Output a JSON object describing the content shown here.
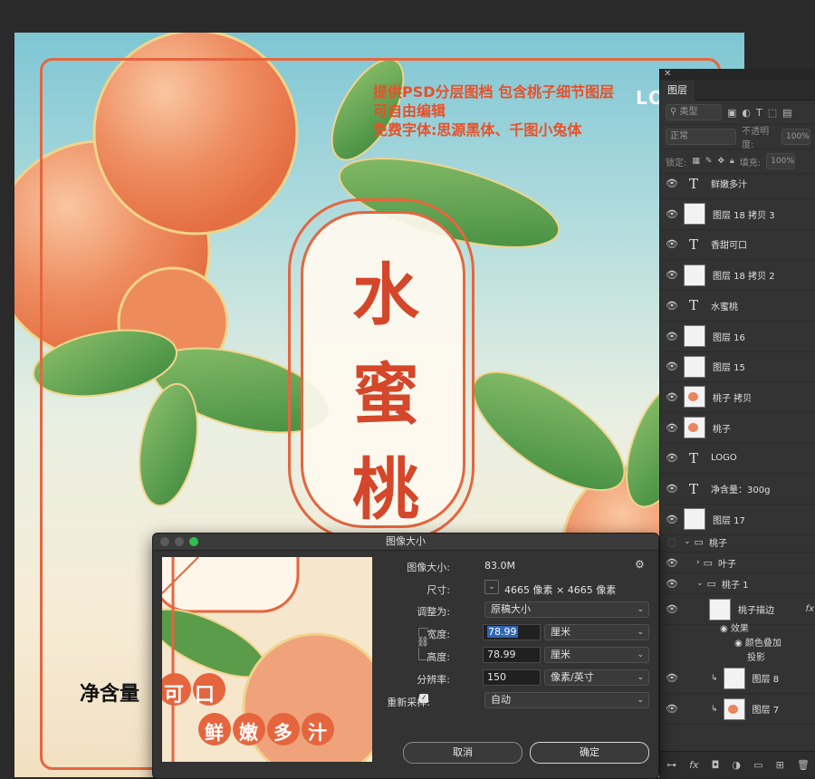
{
  "canvas": {
    "promo_lines": [
      "提供PSD分层图档 包含桃子细节图层",
      "可自由编辑",
      "免费字体:思源黑体、千图小兔体"
    ],
    "logo_text": "LOG",
    "title_chars": [
      "水",
      "蜜",
      "桃"
    ],
    "net_weight": "净含量"
  },
  "layers_panel": {
    "tab": "图层",
    "filter_kind": "类型",
    "blend_mode": "正常",
    "opacity_label": "不透明度:",
    "opacity_value": "100%",
    "lock_label": "锁定:",
    "fill_label": "填充:",
    "fill_value": "100%",
    "layers": [
      {
        "name": "鲜嫩多汁",
        "kind": "text"
      },
      {
        "name": "图层 18 拷贝 3",
        "kind": "pixel"
      },
      {
        "name": "香甜可口",
        "kind": "text"
      },
      {
        "name": "图层 18 拷贝 2",
        "kind": "pixel"
      },
      {
        "name": "水蜜桃",
        "kind": "text"
      },
      {
        "name": "图层 16",
        "kind": "pixel"
      },
      {
        "name": "图层 15",
        "kind": "pixel"
      },
      {
        "name": "桃子 拷贝",
        "kind": "peach"
      },
      {
        "name": "桃子",
        "kind": "peach"
      },
      {
        "name": "LOGO",
        "kind": "text"
      },
      {
        "name": "净含量：300g",
        "kind": "text"
      },
      {
        "name": "图层 17",
        "kind": "pixel"
      }
    ],
    "group_peach": "桃子",
    "group_leaf": "叶子",
    "group_peach1": "桃子 1",
    "stroke_layer": "桃子描边",
    "fx_symbol": "fx",
    "effects_label": "效果",
    "effect_color_overlay": "颜色叠加",
    "effect_shadow": "投影",
    "layer8": "图层 8",
    "layer7": "图层 7"
  },
  "dialog": {
    "title": "图像大小",
    "image_size_label": "图像大小:",
    "image_size_value": "83.0M",
    "dimensions_label": "尺寸:",
    "dimensions_value": "4665 像素 × 4665 像素",
    "fit_label": "调整为:",
    "fit_value": "原稿大小",
    "width_label": "宽度:",
    "width_value": "78.99",
    "width_unit": "厘米",
    "height_label": "高度:",
    "height_value": "78.99",
    "height_unit": "厘米",
    "resolution_label": "分辨率:",
    "resolution_value": "150",
    "resolution_unit": "像素/英寸",
    "resample_label": "重新采样:",
    "resample_value": "自动",
    "cancel": "取消",
    "ok": "确定",
    "preview_texts": {
      "sweet": "可口",
      "juicy": [
        "鲜",
        "嫩",
        "多",
        "汁"
      ]
    }
  }
}
